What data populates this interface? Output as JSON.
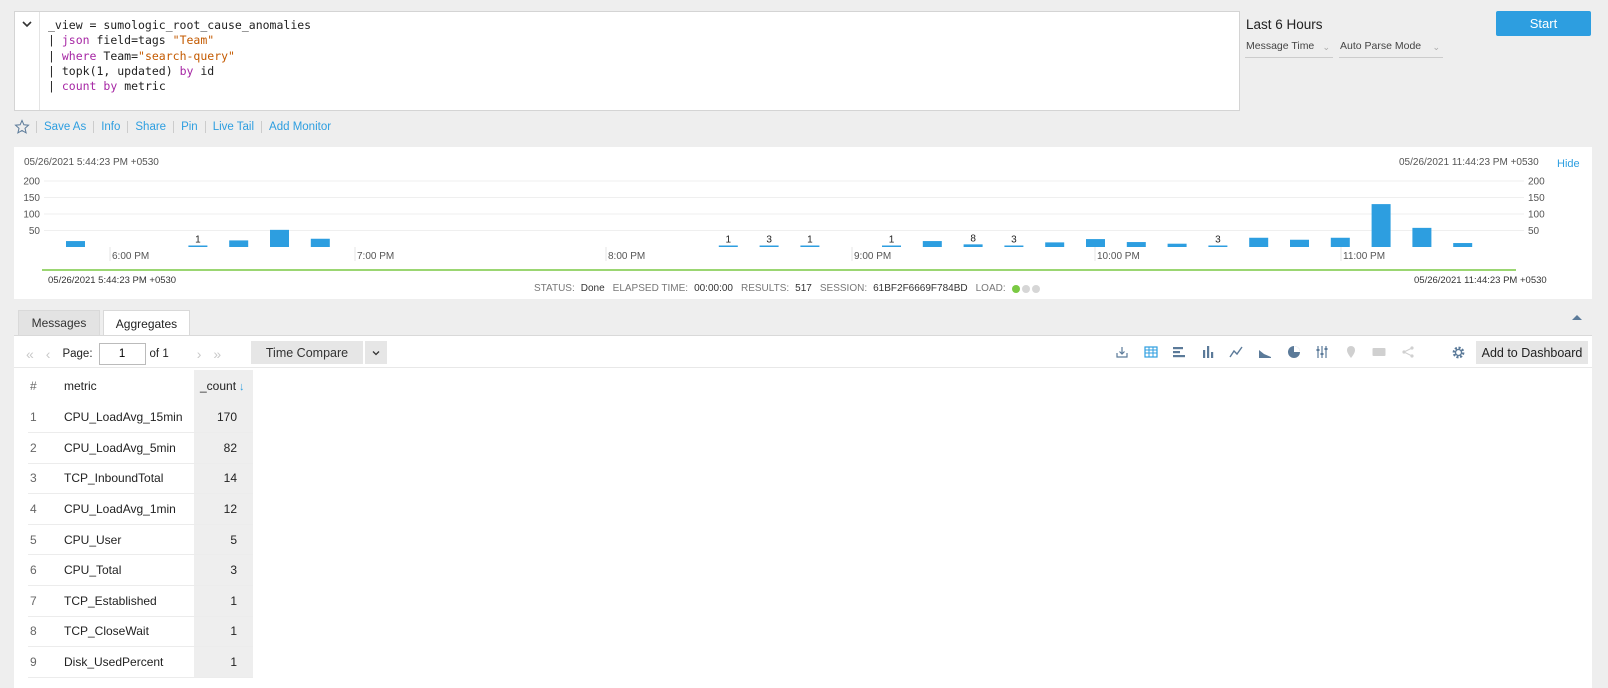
{
  "query": {
    "line1": "_view = sumologic_root_cause_anomalies",
    "line2": {
      "pipe": "| ",
      "kw": "json",
      "rest": " field=tags ",
      "str": "\"Team\""
    },
    "line3": {
      "pipe": "| ",
      "kw": "where",
      "rest": " Team=",
      "str": "\"search-query\""
    },
    "line4": {
      "pipe": "| ",
      "kw": "topk",
      "rest": "(1, updated) ",
      "kw2": "by",
      "rest2": " id"
    },
    "line5": {
      "pipe": "| ",
      "kw": "count",
      "rest": " ",
      "kw2": "by",
      "rest2": " metric"
    }
  },
  "time_range": "Last 6 Hours",
  "message_time": "Message Time",
  "parse_mode": "Auto Parse Mode",
  "start_label": "Start",
  "actions": [
    "Save As",
    "Info",
    "Share",
    "Pin",
    "Live Tail",
    "Add Monitor"
  ],
  "histogram": {
    "start_ts": "05/26/2021 5:44:23 PM +0530",
    "end_ts": "05/26/2021 11:44:23 PM +0530",
    "hide_label": "Hide",
    "y_ticks": [
      "200",
      "150",
      "100",
      "50"
    ],
    "x_ticks": [
      "6:00 PM",
      "7:00 PM",
      "8:00 PM",
      "9:00 PM",
      "10:00 PM",
      "11:00 PM"
    ],
    "bars": [
      {
        "slot": 0,
        "value": 18,
        "label": ""
      },
      {
        "slot": 3,
        "value": 1,
        "label": "1"
      },
      {
        "slot": 4,
        "value": 20,
        "label": ""
      },
      {
        "slot": 5,
        "value": 52,
        "label": ""
      },
      {
        "slot": 6,
        "value": 25,
        "label": ""
      },
      {
        "slot": 16,
        "value": 1,
        "label": "1"
      },
      {
        "slot": 17,
        "value": 3,
        "label": "3"
      },
      {
        "slot": 18,
        "value": 1,
        "label": "1"
      },
      {
        "slot": 20,
        "value": 1,
        "label": "1"
      },
      {
        "slot": 21,
        "value": 18,
        "label": ""
      },
      {
        "slot": 22,
        "value": 8,
        "label": "8"
      },
      {
        "slot": 23,
        "value": 3,
        "label": "3"
      },
      {
        "slot": 24,
        "value": 14,
        "label": ""
      },
      {
        "slot": 25,
        "value": 24,
        "label": ""
      },
      {
        "slot": 26,
        "value": 15,
        "label": ""
      },
      {
        "slot": 27,
        "value": 10,
        "label": ""
      },
      {
        "slot": 28,
        "value": 3,
        "label": "3"
      },
      {
        "slot": 29,
        "value": 28,
        "label": ""
      },
      {
        "slot": 30,
        "value": 22,
        "label": ""
      },
      {
        "slot": 31,
        "value": 28,
        "label": ""
      },
      {
        "slot": 32,
        "value": 130,
        "label": ""
      },
      {
        "slot": 33,
        "value": 58,
        "label": ""
      },
      {
        "slot": 34,
        "value": 12,
        "label": ""
      }
    ],
    "bar_color": "#2d9ee0"
  },
  "status": {
    "status_label": "STATUS:",
    "status_value": "Done",
    "elapsed_label": "ELAPSED TIME:",
    "elapsed_value": "00:00:00",
    "results_label": "RESULTS:",
    "results_value": "517",
    "session_label": "SESSION:",
    "session_value": "61BF2F6669F784BD",
    "load_label": "LOAD:"
  },
  "tabs": [
    "Messages",
    "Aggregates"
  ],
  "pager": {
    "page_label": "Page:",
    "page_value": "1",
    "of_label": "of 1"
  },
  "time_compare_label": "Time Compare",
  "add_dashboard_label": "Add to Dashboard",
  "table": {
    "headers": [
      "#",
      "metric",
      "_count"
    ],
    "rows": [
      [
        "1",
        "CPU_LoadAvg_15min",
        "170"
      ],
      [
        "2",
        "CPU_LoadAvg_5min",
        "82"
      ],
      [
        "3",
        "TCP_InboundTotal",
        "14"
      ],
      [
        "4",
        "CPU_LoadAvg_1min",
        "12"
      ],
      [
        "5",
        "CPU_User",
        "5"
      ],
      [
        "6",
        "CPU_Total",
        "3"
      ],
      [
        "7",
        "TCP_Established",
        "1"
      ],
      [
        "8",
        "TCP_CloseWait",
        "1"
      ],
      [
        "9",
        "Disk_UsedPercent",
        "1"
      ]
    ]
  }
}
